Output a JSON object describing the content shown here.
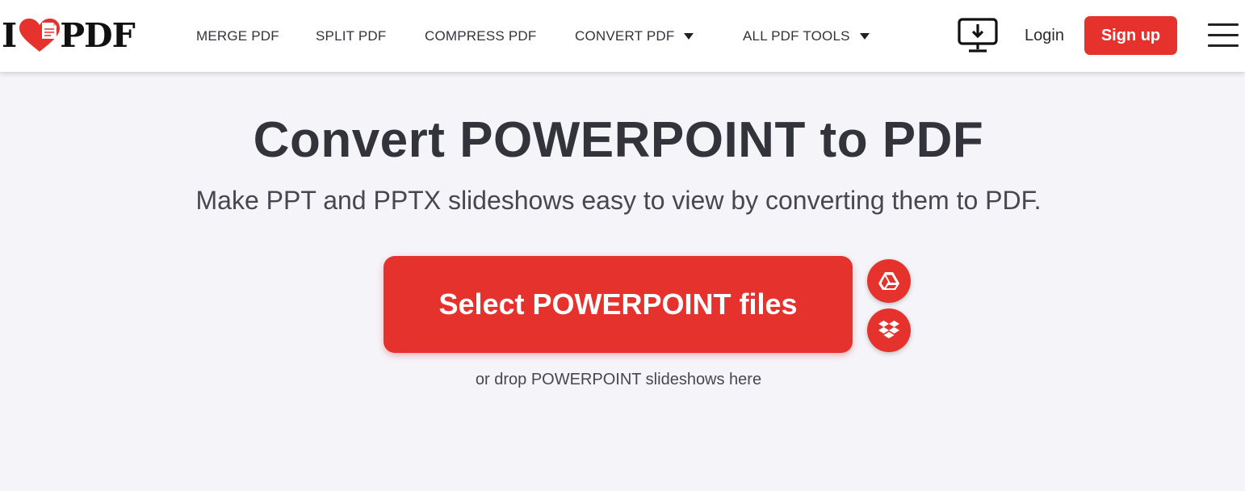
{
  "header": {
    "logo": {
      "left": "I",
      "right": "PDF"
    },
    "nav": [
      {
        "label": "MERGE PDF",
        "dropdown": false
      },
      {
        "label": "SPLIT PDF",
        "dropdown": false
      },
      {
        "label": "COMPRESS PDF",
        "dropdown": false
      },
      {
        "label": "CONVERT PDF",
        "dropdown": true
      },
      {
        "label": "ALL PDF TOOLS",
        "dropdown": true
      }
    ],
    "desktop_icon": "desktop-download-icon",
    "login_label": "Login",
    "signup_label": "Sign up",
    "menu_icon": "hamburger-menu-icon"
  },
  "main": {
    "title": "Convert POWERPOINT to PDF",
    "subtitle": "Make PPT and PPTX slideshows easy to view by converting them to PDF.",
    "select_button_label": "Select POWERPOINT files",
    "cloud_sources": [
      {
        "icon": "google-drive-icon"
      },
      {
        "icon": "dropbox-icon"
      }
    ],
    "drop_hint": "or drop POWERPOINT slideshows here"
  },
  "colors": {
    "accent": "#e5322d",
    "background": "#f4f4f9",
    "header_bg": "#ffffff",
    "text": "#33333b"
  }
}
